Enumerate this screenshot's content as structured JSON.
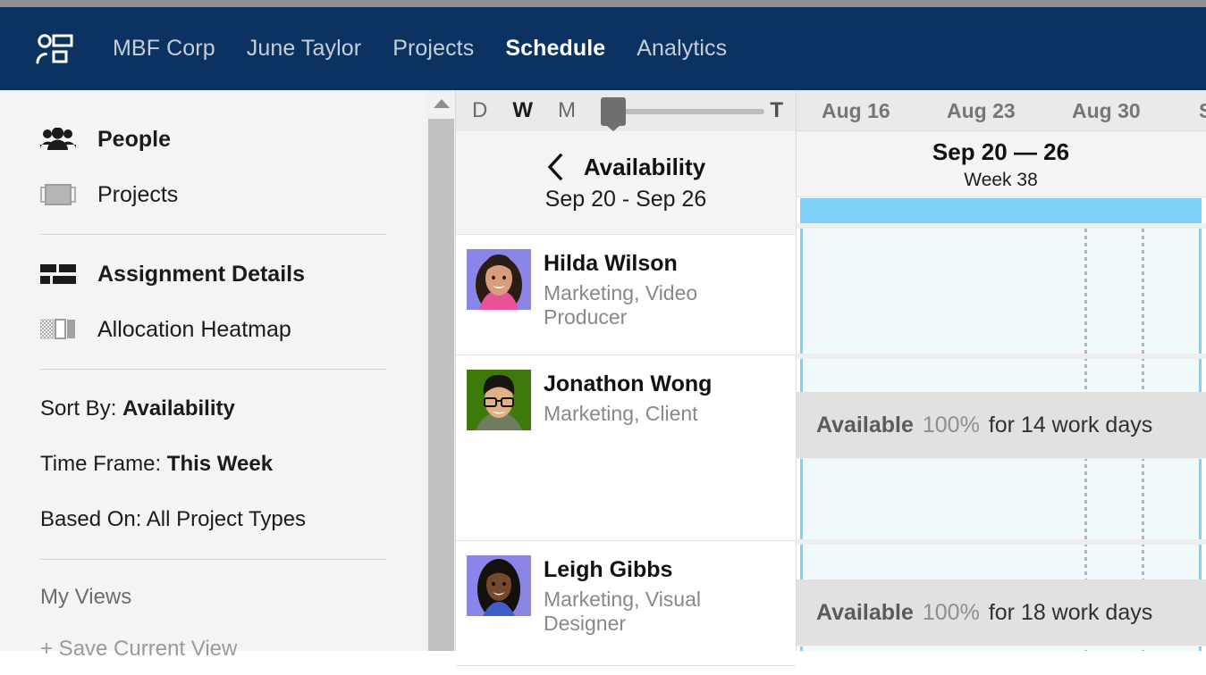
{
  "navbar": {
    "logo_icon": "people-list-icon",
    "links": [
      {
        "label": "MBF Corp",
        "active": false
      },
      {
        "label": "June Taylor",
        "active": false
      },
      {
        "label": "Projects",
        "active": false
      },
      {
        "label": "Schedule",
        "active": true
      },
      {
        "label": "Analytics",
        "active": false
      }
    ]
  },
  "sidebar": {
    "nav_items": [
      {
        "label": "People",
        "icon": "people-icon",
        "selected": true
      },
      {
        "label": "Projects",
        "icon": "project-bar-icon",
        "selected": false
      }
    ],
    "view_items": [
      {
        "label": "Assignment Details",
        "icon": "assignment-bars-icon",
        "selected": true
      },
      {
        "label": "Allocation Heatmap",
        "icon": "heatmap-icon",
        "selected": false
      }
    ],
    "filters": [
      {
        "prefix": "Sort By: ",
        "value": "Availability"
      },
      {
        "prefix": "Time Frame: ",
        "value": "This Week"
      },
      {
        "prefix": "Based On: ",
        "value": "All Project Types"
      }
    ],
    "my_views_label": "My Views",
    "save_view_label": "+ Save Current View"
  },
  "scrollbar": {
    "up_arrow_icon": "caret-up-icon"
  },
  "toolbar": {
    "units": [
      {
        "label": "D",
        "active": false
      },
      {
        "label": "W",
        "active": true
      },
      {
        "label": "M",
        "active": false
      }
    ],
    "zoom_slider_value": 0,
    "today_label": "T"
  },
  "availability_header": {
    "back_icon": "chevron-left-icon",
    "title": "Availability",
    "range": "Sep 20 - Sep 26"
  },
  "people": [
    {
      "name": "Hilda Wilson",
      "role": "Marketing, Video Producer",
      "avatar_bg": "#8a86e8",
      "avatar_hair": "#2b1c14",
      "avatar_skin": "#d89e7c",
      "avatar_shirt": "#e8529b"
    },
    {
      "name": "Jonathon Wong",
      "role": "Marketing, Client",
      "avatar_bg": "#3d7a0a",
      "avatar_hair": "#1a1510",
      "avatar_skin": "#e0b184",
      "avatar_shirt": "#6f7d5c"
    },
    {
      "name": "Leigh Gibbs",
      "role": "Marketing, Visual Designer",
      "avatar_bg": "#8a86e8",
      "avatar_hair": "#14100d",
      "avatar_skin": "#77492c",
      "avatar_shirt": "#3f5ec9"
    }
  ],
  "timeline": {
    "months": [
      {
        "label": "Aug 16"
      },
      {
        "label": "Aug 23"
      },
      {
        "label": "Aug 30"
      },
      {
        "label": "S"
      }
    ],
    "current_week": {
      "title": "Sep 20 — 26",
      "subtitle": "Week 38",
      "highlight_color": "#7ed0f7"
    },
    "availability_bars": [
      {
        "status": "Available",
        "percent": "100%",
        "detail": "for 14 work days"
      },
      {
        "status": "Available",
        "percent": "100%",
        "detail": "for 18 work days"
      }
    ]
  },
  "colors": {
    "navbar_bg": "#0b3260",
    "top_strip": "#8d9196",
    "sidebar_bg": "#f4f4f4",
    "week_highlight": "#7ed0f7",
    "week_column_bg": "#f0fafd",
    "avail_bar_bg": "#e3e1e0"
  }
}
